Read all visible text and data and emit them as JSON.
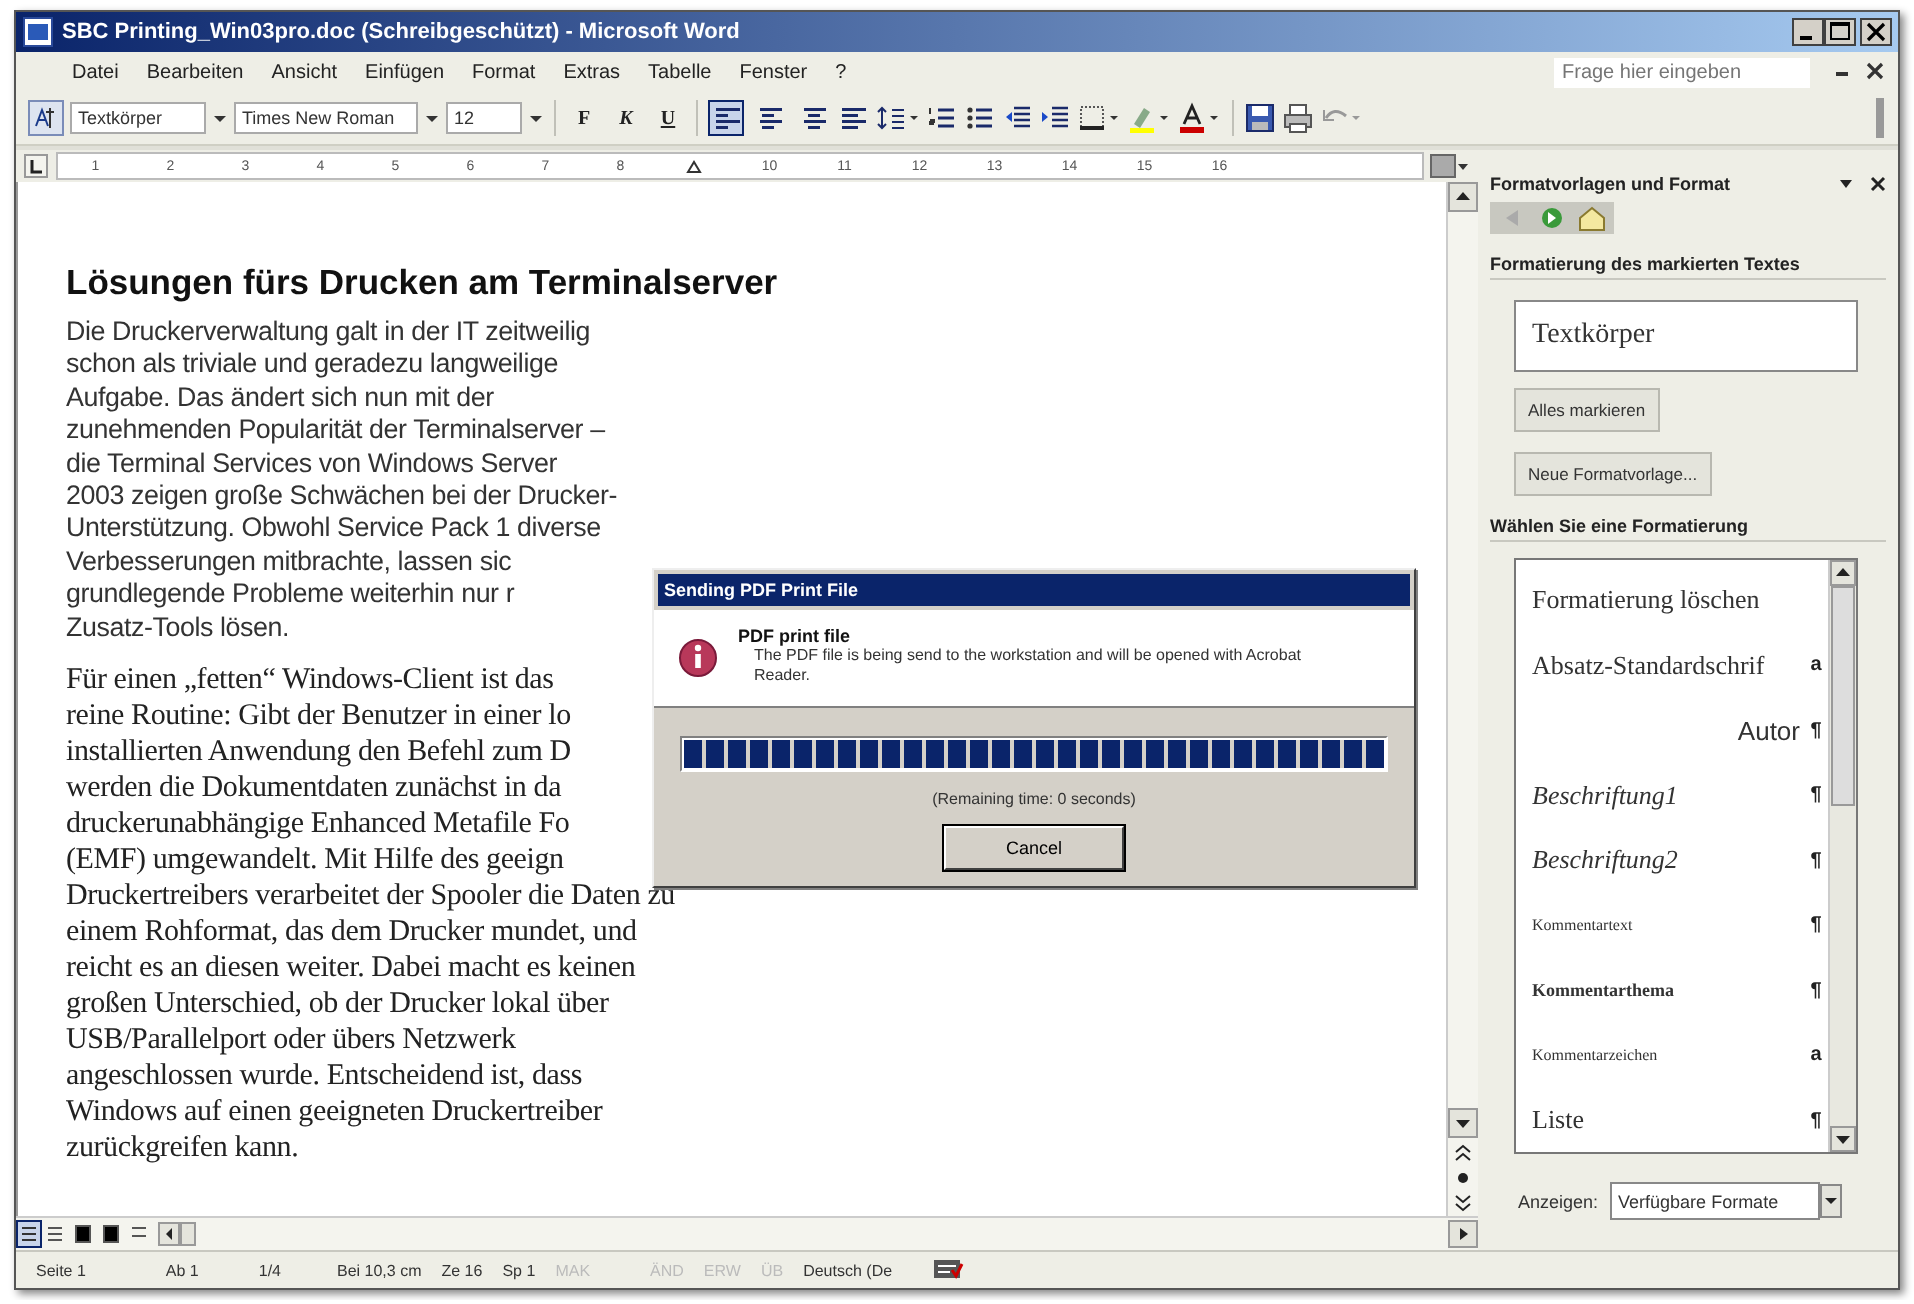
{
  "window": {
    "title": "SBC Printing_Win03pro.doc (Schreibgeschützt) - Microsoft Word"
  },
  "menu": [
    "Datei",
    "Bearbeiten",
    "Ansicht",
    "Einfügen",
    "Format",
    "Extras",
    "Tabelle",
    "Fenster",
    "?"
  ],
  "help_box": {
    "placeholder": "Frage hier eingeben"
  },
  "toolbar": {
    "style": "Textkörper",
    "font": "Times New Roman",
    "size": "12",
    "format_buttons": [
      {
        "label": "F",
        "kind": "bold",
        "selected": false
      },
      {
        "label": "K",
        "kind": "italic",
        "selected": false
      },
      {
        "label": "U",
        "kind": "underline",
        "selected": false
      }
    ],
    "align_buttons": [
      {
        "selected": true
      },
      {
        "selected": false
      },
      {
        "selected": false
      },
      {
        "selected": false
      }
    ]
  },
  "ruler": {
    "marks": [
      "1",
      "2",
      "3",
      "4",
      "5",
      "6",
      "7",
      "8",
      "10",
      "11",
      "12",
      "13",
      "14",
      "15",
      "16"
    ]
  },
  "document": {
    "heading": "Lösungen fürs Drucken am Terminalserver",
    "paragraphs": [
      {
        "kind": "sans",
        "lines": [
          "Die Druckerverwaltung galt in der IT zeitweilig",
          "schon als triviale und geradezu langweilige",
          "Aufgabe. Das ändert sich nun mit der",
          "zunehmenden Popularität der Terminalserver –",
          "die Terminal Services von Windows Server",
          "2003 zeigen große Schwächen bei der Drucker-",
          "Unterstützung. Obwohl Service Pack 1 diverse",
          "Verbesserungen mitbrachte, lassen sic",
          "grundlegende Probleme weiterhin nur r",
          "Zusatz-Tools lösen."
        ]
      },
      {
        "kind": "serif",
        "lines": [
          "Für einen „fetten“ Windows-Client ist das",
          "reine Routine: Gibt der Benutzer in einer lo",
          "installierten Anwendung den Befehl zum D",
          "werden die Dokumentdaten zunächst in da",
          "druckerunabhängige Enhanced Metafile Fo",
          "(EMF) umgewandelt. Mit Hilfe des geeign",
          "Druckertreibers verarbeitet der Spooler die Daten zu",
          "einem Rohformat, das dem Drucker mundet, und",
          "reicht es an diesen weiter. Dabei macht es keinen",
          "großen Unterschied, ob der Drucker lokal über",
          "USB/Parallelport oder übers Netzwerk",
          "angeschlossen wurde. Entscheidend ist, dass",
          "Windows auf einen geeigneten Druckertreiber",
          "zurückgreifen kann."
        ]
      }
    ]
  },
  "dialog": {
    "title": "Sending PDF Print File",
    "heading": "PDF print file",
    "message": "The PDF file is being send to the workstation and will be opened with Acrobat Reader.",
    "progress": {
      "level": 1
    },
    "remaining": "(Remaining time: 0 seconds)",
    "button": "Cancel"
  },
  "task_pane": {
    "title": "Formatvorlagen und Format",
    "section_1": "Formatierung des markierten Textes",
    "current_style": "Textkörper",
    "buttons": [
      "Alles markieren",
      "Neue Formatvorlage..."
    ],
    "section_2": "Wählen Sie eine Formatierung",
    "styles": [
      {
        "label": "Formatierung löschen",
        "kind": "plain"
      },
      {
        "label": "Absatz-Standardschrif",
        "mark": "a",
        "kind": "plain"
      },
      {
        "label": "Autor",
        "mark": "¶",
        "kind": "right"
      },
      {
        "label": "Beschriftung1",
        "mark": "¶",
        "kind": "italic"
      },
      {
        "label": "Beschriftung2",
        "mark": "¶",
        "kind": "italic"
      },
      {
        "label": "Kommentartext",
        "mark": "¶",
        "kind": "small"
      },
      {
        "label": "Kommentarthema",
        "mark": "¶",
        "kind": "smallbold"
      },
      {
        "label": "Kommentarzeichen",
        "mark": "a",
        "kind": "small"
      },
      {
        "label": "Liste",
        "mark": "¶",
        "kind": "plain"
      }
    ],
    "show_label": "Anzeigen:",
    "show_value": "Verfügbare Formate"
  },
  "status_bar": {
    "fields": [
      {
        "label": "Seite 1",
        "disabled": false
      },
      {
        "label": "Ab 1",
        "disabled": false
      },
      {
        "label": "1/4",
        "disabled": false
      },
      {
        "label": "Bei 10,3 cm",
        "disabled": false
      },
      {
        "label": "Ze 16",
        "disabled": false
      },
      {
        "label": "Sp 1",
        "disabled": false
      },
      {
        "label": "MAK",
        "disabled": true
      },
      {
        "label": "ÄND",
        "disabled": true
      },
      {
        "label": "ERW",
        "disabled": true
      },
      {
        "label": "ÜB",
        "disabled": true
      },
      {
        "label": "Deutsch (De",
        "disabled": false
      }
    ]
  }
}
